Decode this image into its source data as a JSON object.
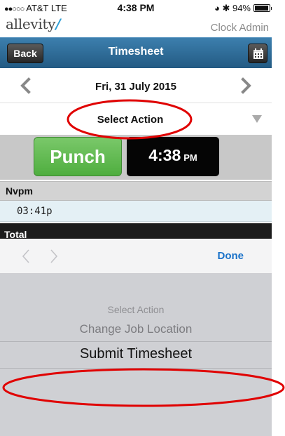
{
  "status_bar": {
    "carrier": "AT&T  LTE",
    "time": "4:38 PM",
    "battery": "94%",
    "battery_level": 0.94
  },
  "brand": {
    "logo": "allevity",
    "role": "Clock Admin"
  },
  "nav": {
    "back_label": "Back",
    "title": "Timesheet",
    "calendar_icon": "calendar-icon"
  },
  "date_row": {
    "date": "Fri, 31 July 2015"
  },
  "action_select": {
    "selected": "Select Action"
  },
  "punch": {
    "button_label": "Punch",
    "clock_time": "4:38",
    "clock_ampm": "PM"
  },
  "timesheet": {
    "section_title": "Nvpm",
    "entries": [
      {
        "time": "03:41p"
      }
    ],
    "total_label": "Total"
  },
  "picker": {
    "done_label": "Done",
    "options": [
      "Select Action",
      "Change Job Location",
      "Submit Timesheet"
    ],
    "selected_index": 2
  },
  "colors": {
    "nav_blue": "#2f6c98",
    "punch_green": "#5cb84c",
    "annotation_red": "#e00000",
    "link_blue": "#1a72c9"
  }
}
